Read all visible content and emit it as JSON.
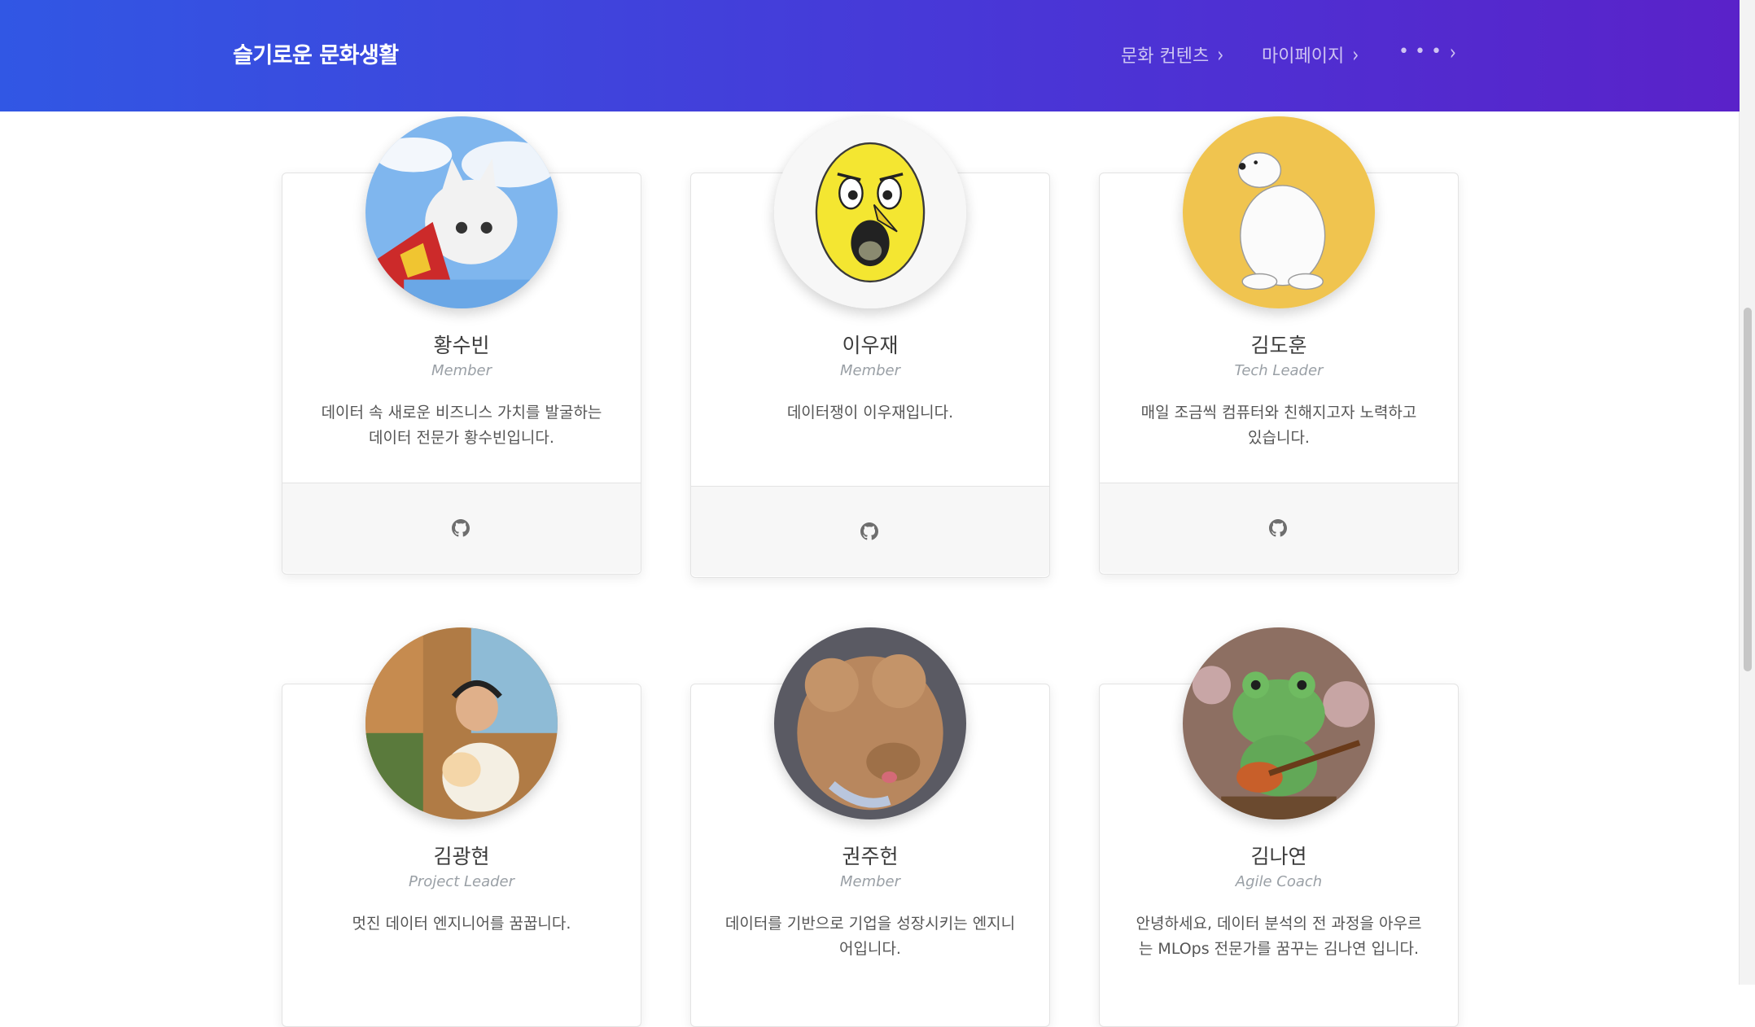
{
  "navbar": {
    "brand": "슬기로운 문화생활",
    "items": [
      {
        "label": "문화 컨텐츠",
        "chevron": "›"
      },
      {
        "label": "마이페이지",
        "chevron": "›"
      },
      {
        "label": "• • •",
        "chevron": "›"
      }
    ]
  },
  "team": [
    {
      "name": "황수빈",
      "role": "Member",
      "description": "데이터 속 새로운 비즈니스 가치를 발굴하는 데이터 전문가 황수빈입니다.",
      "icon": "github-icon"
    },
    {
      "name": "이우재",
      "role": "Member",
      "description": "데이터쟁이 이우재입니다.",
      "icon": "github-icon"
    },
    {
      "name": "김도훈",
      "role": "Tech Leader",
      "description": "매일 조금씩 컴퓨터와 친해지고자 노력하고 있습니다.",
      "icon": "github-icon"
    },
    {
      "name": "김광현",
      "role": "Project Leader",
      "description": "멋진 데이터 엔지니어를 꿈꿉니다."
    },
    {
      "name": "권주헌",
      "role": "Member",
      "description": "데이터를 기반으로 기업을 성장시키는 엔지니어입니다."
    },
    {
      "name": "김나연",
      "role": "Agile Coach",
      "description": "안녕하세요, 데이터 분석의 전 과정을 아우르는 MLOps 전문가를 꿈꾸는 김나연 입니다."
    }
  ],
  "colors": {
    "nav_gradient_start": "#3157e4",
    "nav_gradient_end": "#5a22c9",
    "role_text": "#9aa0a6"
  }
}
